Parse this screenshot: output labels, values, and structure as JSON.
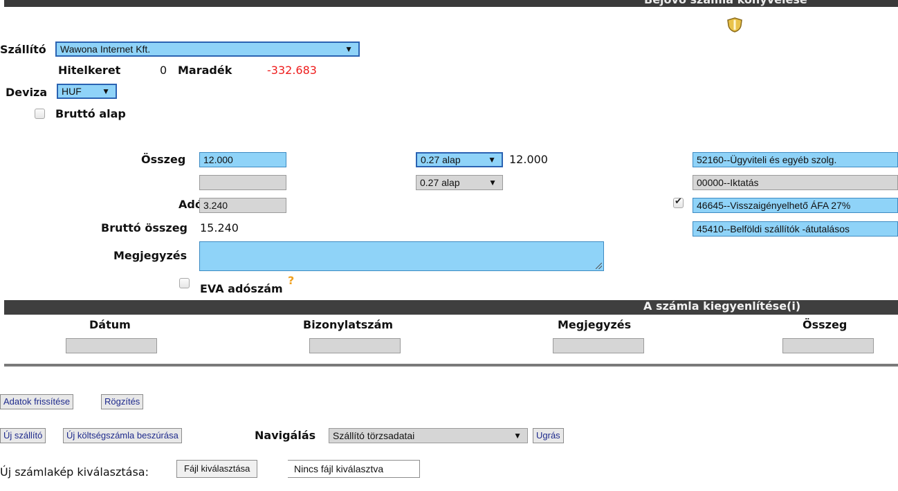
{
  "header": {
    "title": "Bejövő számla könyvelése"
  },
  "supplier": {
    "label": "Szállító",
    "value": "Wawona Internet Kft."
  },
  "credit": {
    "limit_label": "Hitelkeret",
    "limit_value": "0",
    "remaining_label": "Maradék",
    "remaining_value": "-332.683"
  },
  "currency": {
    "label": "Deviza",
    "value": "HUF"
  },
  "gross_base": {
    "label": "Bruttó alap",
    "checked": false
  },
  "amounts": {
    "amount_label": "Összeg",
    "amount_value": "12.000",
    "amount2_value": "",
    "tax_label": "Adó",
    "tax_value": "3.240",
    "gross_label": "Bruttó összeg",
    "gross_value": "15.240",
    "note_label": "Megjegyzés",
    "note_value": ""
  },
  "rates": {
    "rate1": "0.27 alap",
    "rate1_amount": "12.000",
    "rate2": "0.27 alap"
  },
  "accounts": {
    "a1": "52160--Ügyviteli és egyéb szolg.",
    "a2": "00000--Iktatás",
    "a3": "46645--Visszaigényelhető ÁFA 27%",
    "a4": "45410--Belföldi szállítók -átutalásos",
    "a3_checked": true
  },
  "eva": {
    "label": "EVA adószám",
    "help": "?",
    "checked": false
  },
  "settlement": {
    "title": "A számla kiegyenlítése(i)",
    "columns": [
      "Dátum",
      "Bizonylatszám",
      "Megjegyzés",
      "Összeg"
    ]
  },
  "buttons": {
    "refresh": "Adatok frissítése",
    "save": "Rögzítés",
    "new_supplier": "Új szállító",
    "new_invoice": "Új költségszámla beszúrása",
    "nav_label": "Navigálás",
    "nav_value": "Szállító törzsadatai",
    "go": "Ugrás"
  },
  "file": {
    "label": "Új számlakép kiválasztása:",
    "choose": "Fájl kiválasztása",
    "none": "Nincs fájl kiválasztva"
  }
}
